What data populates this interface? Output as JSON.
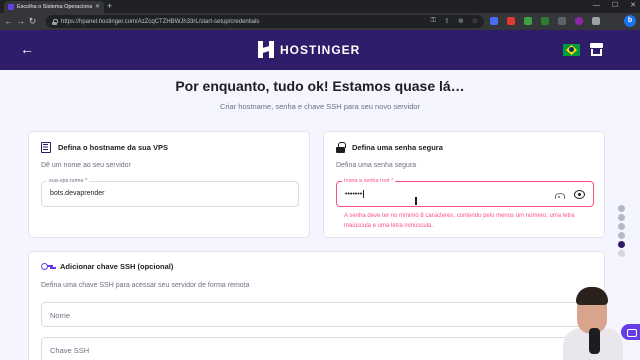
{
  "browser": {
    "tab_title": "Escolha o Sistema Operacional",
    "new_tab": "+",
    "url": "https://hpanel.hostinger.com/AzZcqCTZHBWJh33rL/start-setup/credentials",
    "profile_initial": "b"
  },
  "header": {
    "brand": "HOSTINGER",
    "icons": [
      "back-arrow-icon",
      "brazil-flag-icon",
      "store-icon"
    ]
  },
  "page": {
    "title": "Por enquanto, tudo ok! Estamos quase lá…",
    "subtitle": "Criar hostname, senha e chave SSH para seu novo servidor"
  },
  "hostname_card": {
    "title": "Defina o hostname da sua VPS",
    "description": "Dê um nome ao seu servidor",
    "field_label": "sua-vps.nome *",
    "field_value": "bots.devaprender"
  },
  "password_card": {
    "title": "Defina uma senha segura",
    "description": "Defina uma senha segura",
    "field_label": "Insira a senha root *",
    "field_value": "•••••••",
    "error": "A senha deve ter no mínimo 8 caracteres, contendo pelo menos um número, uma letra maiúscula e uma letra minúscula."
  },
  "ssh_card": {
    "title": "Adicionar chave SSH (opcional)",
    "description": "Defina uma chave SSH para acessar seu servidor de forma remota",
    "name_placeholder": "Nome",
    "key_placeholder": "Chave SSH"
  },
  "progress_steps": [
    "done",
    "done",
    "done",
    "done",
    "current",
    "todo"
  ],
  "colors": {
    "header_bg": "#2f1c6a",
    "accent": "#673de6",
    "error": "#fc5185",
    "page_bg": "#f4f5ff"
  }
}
